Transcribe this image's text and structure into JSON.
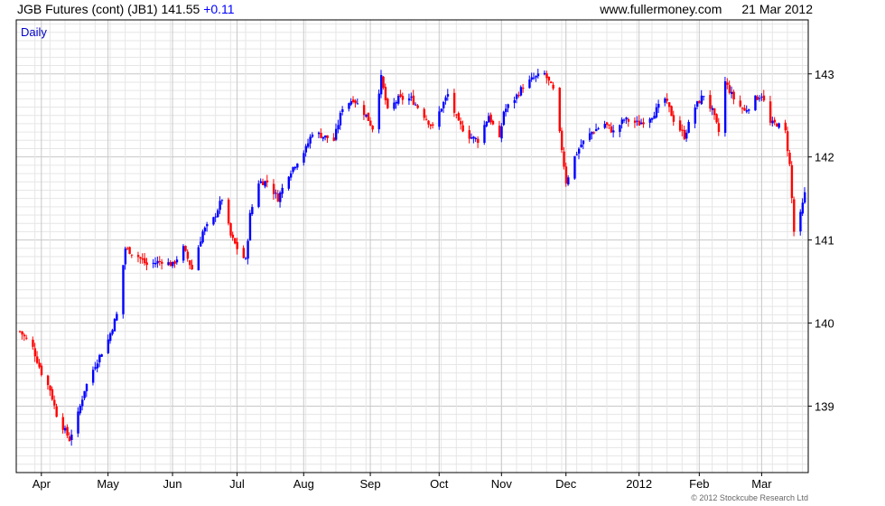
{
  "header": {
    "instrument": "JGB Futures (cont) (JB1)",
    "last": "141.55",
    "change": "+0.11",
    "site": "www.fullermoney.com",
    "date": "21 Mar 2012"
  },
  "chart_data": {
    "type": "ohlc",
    "period_label": "Daily",
    "copyright": "© 2012 Stockcube Research Ltd",
    "up_color": "#0000ff",
    "down_color": "#ff0000",
    "ylim": [
      138.2,
      143.65
    ],
    "yticks": [
      139,
      140,
      141,
      142,
      143
    ],
    "y_axis_side": "right",
    "grid": true,
    "x_range": [
      "2011-03-22",
      "2012-03-21"
    ],
    "xticks": [
      {
        "label": "Apr",
        "date": "2011-04-01"
      },
      {
        "label": "May",
        "date": "2011-05-02"
      },
      {
        "label": "Jun",
        "date": "2011-06-01"
      },
      {
        "label": "Jul",
        "date": "2011-07-01"
      },
      {
        "label": "Aug",
        "date": "2011-08-01"
      },
      {
        "label": "Sep",
        "date": "2011-09-01"
      },
      {
        "label": "Oct",
        "date": "2011-10-03"
      },
      {
        "label": "Nov",
        "date": "2011-11-01"
      },
      {
        "label": "Dec",
        "date": "2011-12-01"
      },
      {
        "label": "2012",
        "date": "2012-01-04"
      },
      {
        "label": "Feb",
        "date": "2012-02-01"
      },
      {
        "label": "Mar",
        "date": "2012-03-01"
      }
    ],
    "close_path": [
      [
        "2011-03-22",
        139.9
      ],
      [
        "2011-03-28",
        139.7
      ],
      [
        "2011-04-01",
        139.4
      ],
      [
        "2011-04-05",
        139.2
      ],
      [
        "2011-04-08",
        138.9
      ],
      [
        "2011-04-12",
        138.7
      ],
      [
        "2011-04-14",
        138.6
      ],
      [
        "2011-04-18",
        138.9
      ],
      [
        "2011-04-21",
        139.2
      ],
      [
        "2011-04-26",
        139.5
      ],
      [
        "2011-05-02",
        139.8
      ],
      [
        "2011-05-06",
        140.1
      ],
      [
        "2011-05-10",
        140.9
      ],
      [
        "2011-05-16",
        140.8
      ],
      [
        "2011-05-20",
        140.7
      ],
      [
        "2011-05-27",
        140.75
      ],
      [
        "2011-06-01",
        140.7
      ],
      [
        "2011-06-06",
        140.9
      ],
      [
        "2011-06-10",
        140.65
      ],
      [
        "2011-06-15",
        141.1
      ],
      [
        "2011-06-20",
        141.25
      ],
      [
        "2011-06-24",
        141.5
      ],
      [
        "2011-06-28",
        141.05
      ],
      [
        "2011-07-01",
        140.9
      ],
      [
        "2011-07-05",
        140.75
      ],
      [
        "2011-07-07",
        141.3
      ],
      [
        "2011-07-11",
        141.7
      ],
      [
        "2011-07-15",
        141.7
      ],
      [
        "2011-07-20",
        141.5
      ],
      [
        "2011-07-25",
        141.8
      ],
      [
        "2011-07-29",
        141.95
      ],
      [
        "2011-08-02",
        142.1
      ],
      [
        "2011-08-05",
        142.3
      ],
      [
        "2011-08-10",
        142.25
      ],
      [
        "2011-08-15",
        142.2
      ],
      [
        "2011-08-19",
        142.6
      ],
      [
        "2011-08-24",
        142.7
      ],
      [
        "2011-08-30",
        142.5
      ],
      [
        "2011-09-02",
        142.35
      ],
      [
        "2011-09-06",
        142.95
      ],
      [
        "2011-09-09",
        142.55
      ],
      [
        "2011-09-14",
        142.7
      ],
      [
        "2011-09-20",
        142.7
      ],
      [
        "2011-09-26",
        142.5
      ],
      [
        "2011-09-30",
        142.35
      ],
      [
        "2011-10-04",
        142.6
      ],
      [
        "2011-10-07",
        142.75
      ],
      [
        "2011-10-12",
        142.4
      ],
      [
        "2011-10-17",
        142.25
      ],
      [
        "2011-10-21",
        142.2
      ],
      [
        "2011-10-26",
        142.5
      ],
      [
        "2011-10-31",
        142.2
      ],
      [
        "2011-11-02",
        142.55
      ],
      [
        "2011-11-07",
        142.7
      ],
      [
        "2011-11-11",
        142.85
      ],
      [
        "2011-11-16",
        142.95
      ],
      [
        "2011-11-21",
        143.0
      ],
      [
        "2011-11-25",
        142.8
      ],
      [
        "2011-11-29",
        142.1
      ],
      [
        "2011-12-01",
        141.7
      ],
      [
        "2011-12-05",
        142.0
      ],
      [
        "2011-12-08",
        142.15
      ],
      [
        "2011-12-13",
        142.3
      ],
      [
        "2011-12-19",
        142.4
      ],
      [
        "2011-12-23",
        142.3
      ],
      [
        "2011-12-28",
        142.45
      ],
      [
        "2012-01-04",
        142.4
      ],
      [
        "2012-01-10",
        142.5
      ],
      [
        "2012-01-16",
        142.7
      ],
      [
        "2012-01-20",
        142.45
      ],
      [
        "2012-01-25",
        142.25
      ],
      [
        "2012-01-30",
        142.6
      ],
      [
        "2012-02-03",
        142.75
      ],
      [
        "2012-02-07",
        142.55
      ],
      [
        "2012-02-10",
        142.3
      ],
      [
        "2012-02-13",
        142.9
      ],
      [
        "2012-02-17",
        142.7
      ],
      [
        "2012-02-22",
        142.55
      ],
      [
        "2012-02-27",
        142.7
      ],
      [
        "2012-03-01",
        142.75
      ],
      [
        "2012-03-05",
        142.4
      ],
      [
        "2012-03-08",
        142.4
      ],
      [
        "2012-03-12",
        142.3
      ],
      [
        "2012-03-14",
        141.9
      ],
      [
        "2012-03-16",
        141.1
      ],
      [
        "2012-03-19",
        141.3
      ],
      [
        "2012-03-21",
        141.55
      ]
    ]
  }
}
